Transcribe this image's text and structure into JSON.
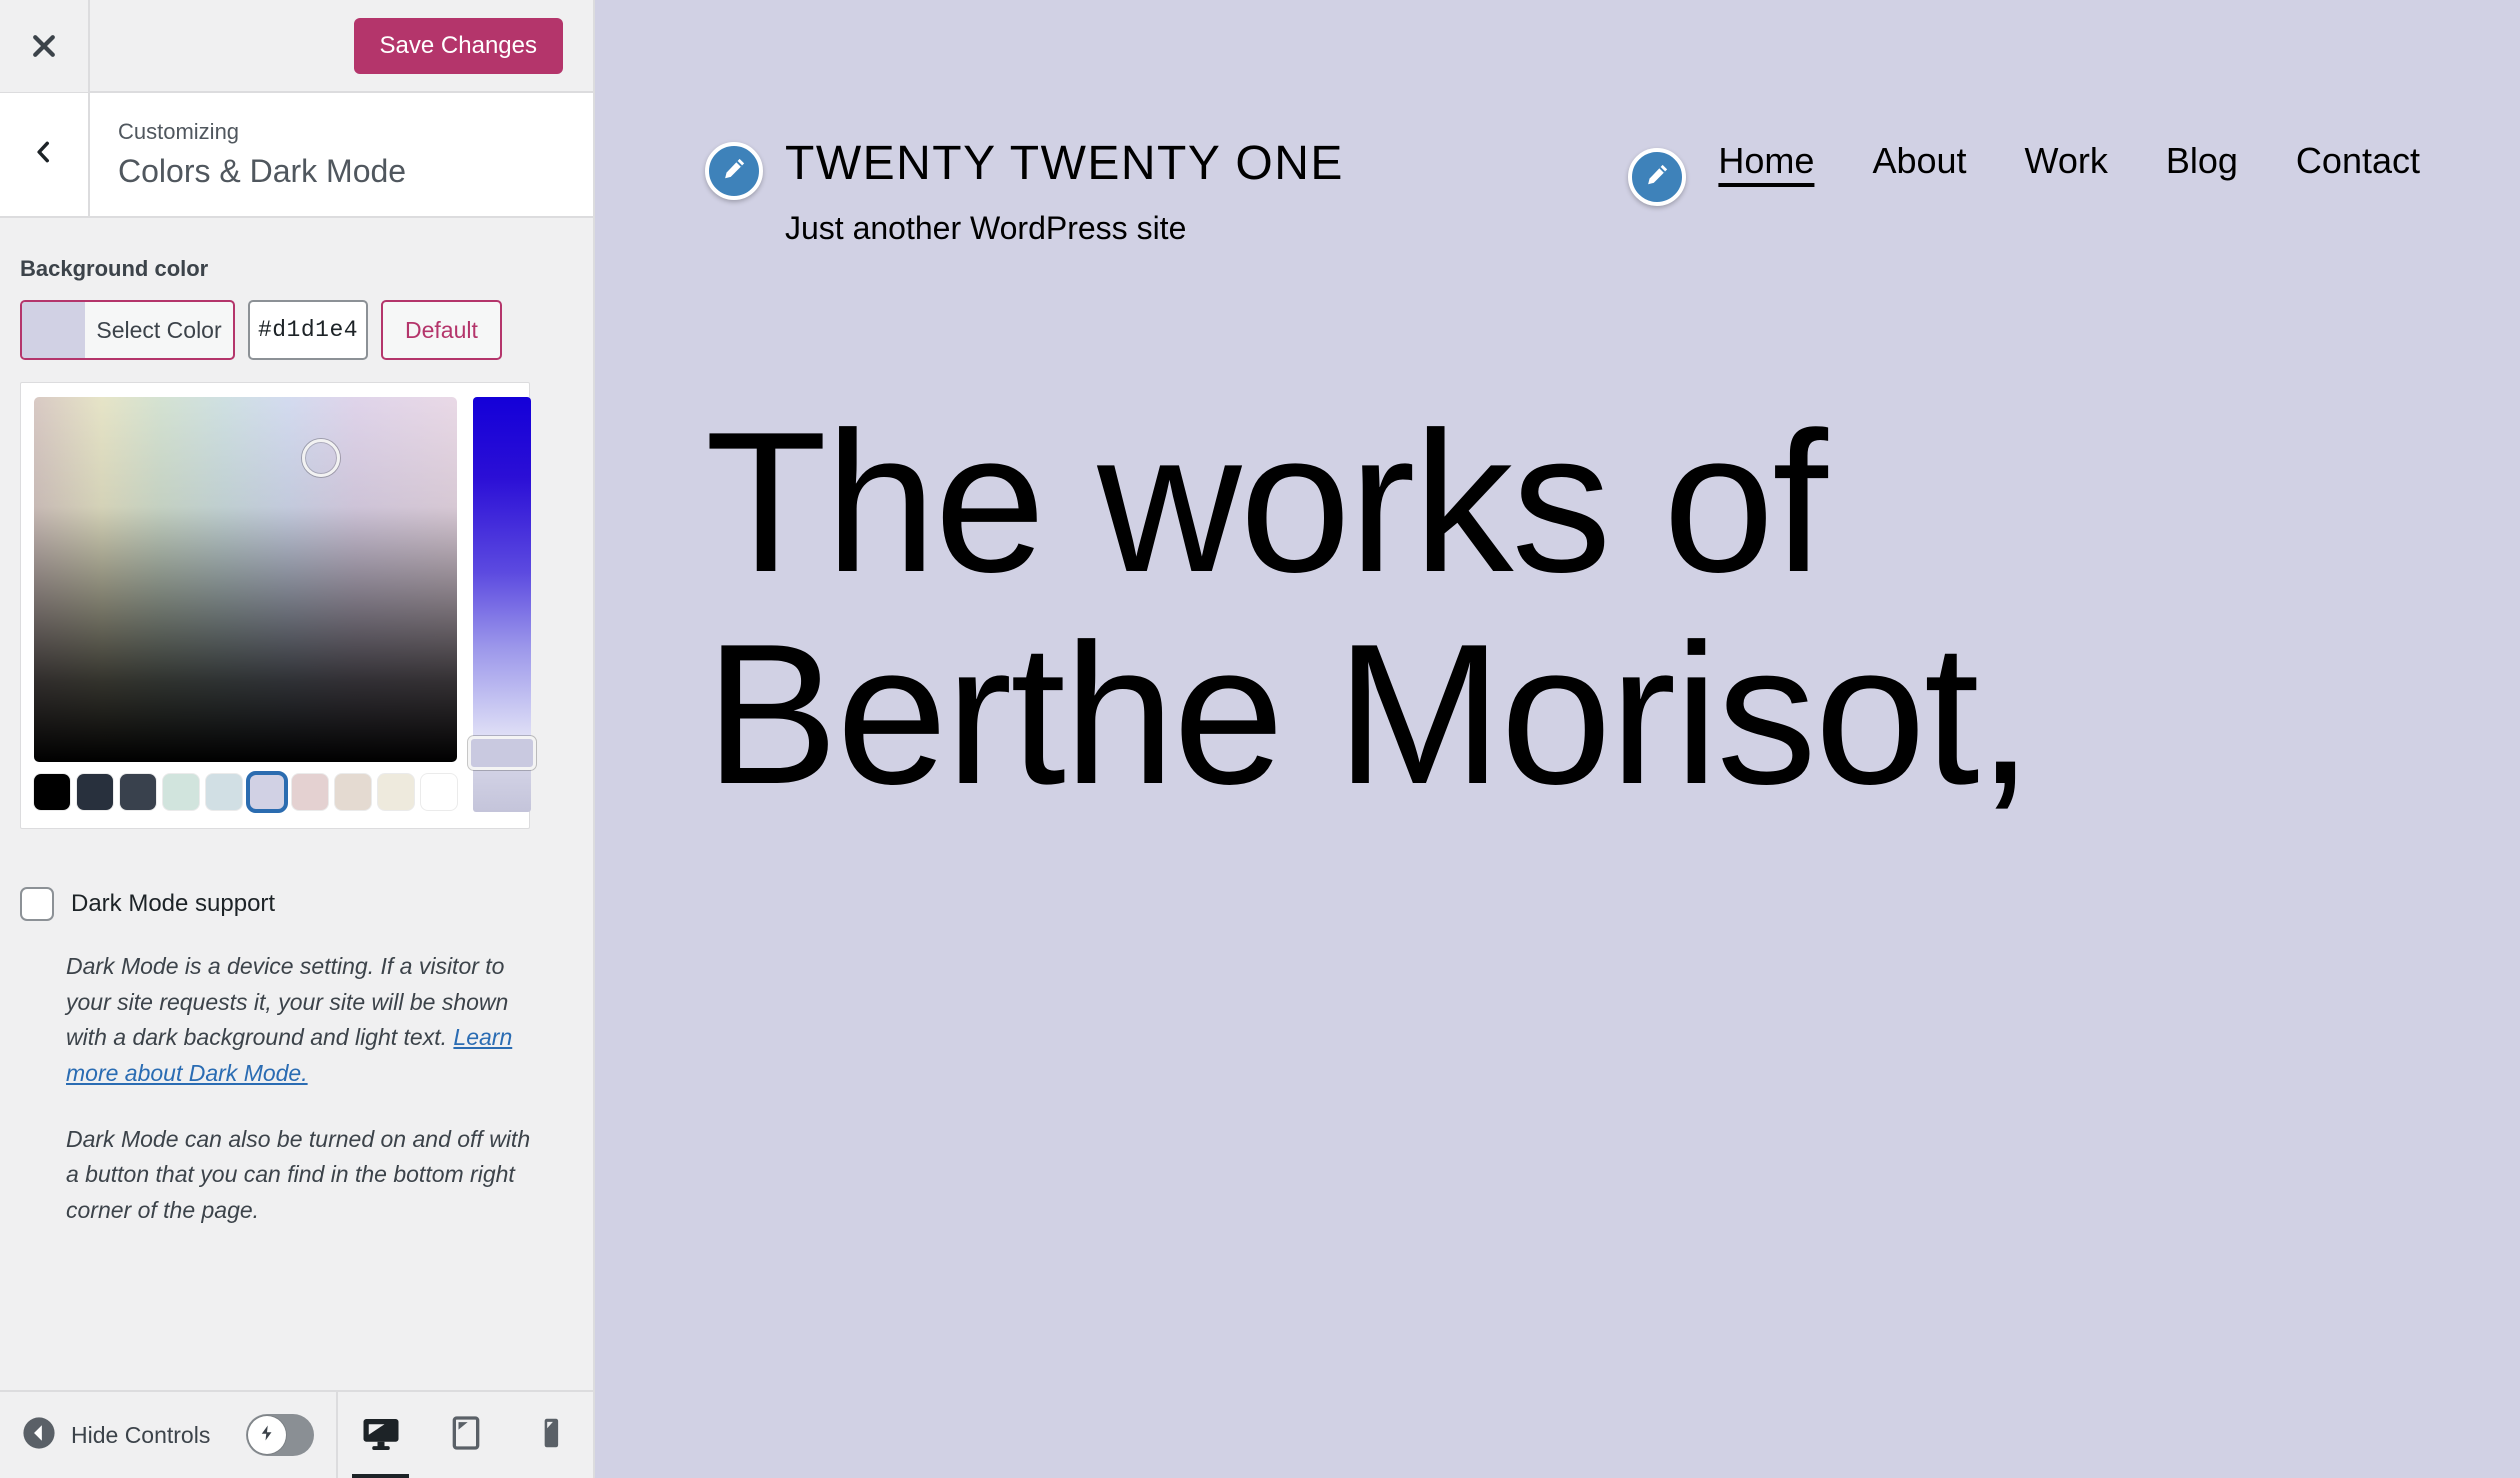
{
  "customizer": {
    "close_icon": "close-x-icon",
    "save_label": "Save Changes",
    "back_icon": "chevron-left-icon",
    "kicker": "Customizing",
    "section_title": "Colors & Dark Mode",
    "accent_color": "#b4356b",
    "background_color_field": {
      "label": "Background color",
      "select_color_label": "Select Color",
      "hex_value": "#d1d1e4",
      "default_label": "Default"
    },
    "color_picker": {
      "swatches": [
        {
          "name": "black",
          "hex": "#000000",
          "selected": false
        },
        {
          "name": "dark-navy",
          "hex": "#28303d",
          "selected": false
        },
        {
          "name": "slate",
          "hex": "#39414d",
          "selected": false
        },
        {
          "name": "mint",
          "hex": "#d1e4dd",
          "selected": false
        },
        {
          "name": "light-blue",
          "hex": "#d1dfe4",
          "selected": false
        },
        {
          "name": "lavender",
          "hex": "#d1d1e4",
          "selected": true
        },
        {
          "name": "pink",
          "hex": "#e4d1d1",
          "selected": false
        },
        {
          "name": "tan",
          "hex": "#e4dad1",
          "selected": false
        },
        {
          "name": "cream",
          "hex": "#eeeadd",
          "selected": false
        },
        {
          "name": "white",
          "hex": "#ffffff",
          "selected": false
        }
      ]
    },
    "dark_mode": {
      "checkbox_label": "Dark Mode support",
      "checked": false,
      "description_1_before": "Dark Mode is a device setting. If a visitor to your site requests it, your site will be shown with a dark background and light text. ",
      "description_1_link": "Learn more about Dark Mode.",
      "description_2": "Dark Mode can also be turned on and off with a button that you can find in the bottom right corner of the page."
    },
    "footer": {
      "hide_controls_label": "Hide Controls",
      "collapse_icon": "collapse-left-circle-icon",
      "preview_toggle_icon": "lightning-bolt-icon",
      "devices": [
        {
          "name": "desktop",
          "icon": "desktop-icon",
          "active": true
        },
        {
          "name": "tablet",
          "icon": "tablet-icon",
          "active": false
        },
        {
          "name": "mobile",
          "icon": "mobile-icon",
          "active": false
        }
      ]
    }
  },
  "preview": {
    "background_color": "#d1d1e4",
    "site_title": "TWENTY TWENTY ONE",
    "tagline": "Just another WordPress site",
    "edit_icon": "pencil-edit-icon",
    "nav": [
      {
        "label": "Home",
        "current": true
      },
      {
        "label": "About",
        "current": false
      },
      {
        "label": "Work",
        "current": false
      },
      {
        "label": "Blog",
        "current": false
      },
      {
        "label": "Contact",
        "current": false
      }
    ],
    "hero_heading": "The works of Berthe Morisot,"
  }
}
